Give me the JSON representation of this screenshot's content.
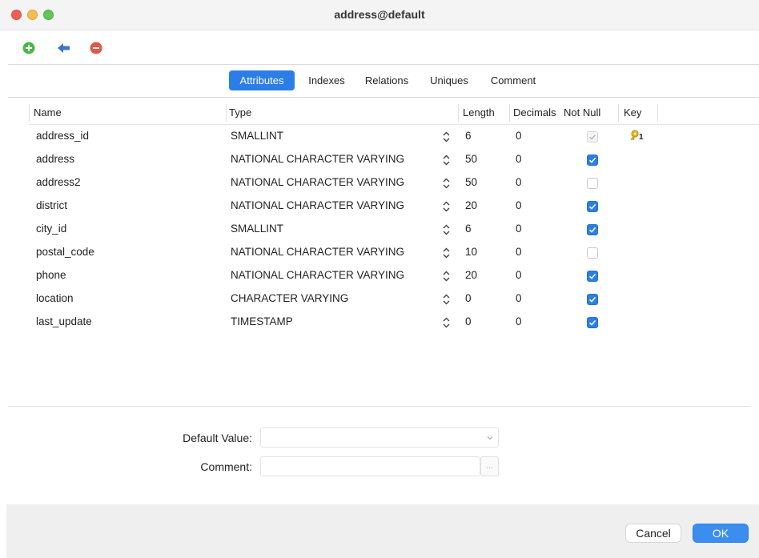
{
  "window": {
    "title": "address@default"
  },
  "toolbar": {
    "add_icon": "plus-circle-icon",
    "back_icon": "arrow-left-icon",
    "remove_icon": "minus-circle-icon"
  },
  "tabs": [
    {
      "label": "Attributes",
      "active": true
    },
    {
      "label": "Indexes",
      "active": false
    },
    {
      "label": "Relations",
      "active": false
    },
    {
      "label": "Uniques",
      "active": false
    },
    {
      "label": "Comment",
      "active": false
    }
  ],
  "grid": {
    "columns": {
      "name": "Name",
      "type": "Type",
      "length": "Length",
      "decimals": "Decimals",
      "not_null": "Not Null",
      "key": "Key"
    },
    "rows": [
      {
        "name": "address_id",
        "type": "SMALLINT",
        "length": "6",
        "decimals": "0",
        "not_null": "disabled-checked",
        "key": "1"
      },
      {
        "name": "address",
        "type": "NATIONAL CHARACTER VARYING",
        "length": "50",
        "decimals": "0",
        "not_null": "checked",
        "key": ""
      },
      {
        "name": "address2",
        "type": "NATIONAL CHARACTER VARYING",
        "length": "50",
        "decimals": "0",
        "not_null": "unchecked",
        "key": ""
      },
      {
        "name": "district",
        "type": "NATIONAL CHARACTER VARYING",
        "length": "20",
        "decimals": "0",
        "not_null": "checked",
        "key": ""
      },
      {
        "name": "city_id",
        "type": "SMALLINT",
        "length": "6",
        "decimals": "0",
        "not_null": "checked",
        "key": ""
      },
      {
        "name": "postal_code",
        "type": "NATIONAL CHARACTER VARYING",
        "length": "10",
        "decimals": "0",
        "not_null": "unchecked",
        "key": ""
      },
      {
        "name": "phone",
        "type": "NATIONAL CHARACTER VARYING",
        "length": "20",
        "decimals": "0",
        "not_null": "checked",
        "key": ""
      },
      {
        "name": "location",
        "type": "CHARACTER VARYING",
        "length": "0",
        "decimals": "0",
        "not_null": "checked",
        "key": ""
      },
      {
        "name": "last_update",
        "type": "TIMESTAMP",
        "length": "0",
        "decimals": "0",
        "not_null": "checked",
        "key": ""
      }
    ]
  },
  "form": {
    "default_value_label": "Default Value:",
    "default_value": "",
    "comment_label": "Comment:",
    "comment_value": "",
    "ellipsis": "..."
  },
  "footer": {
    "cancel_label": "Cancel",
    "ok_label": "OK"
  },
  "colors": {
    "accent": "#2b7ee8",
    "add": "#4cb748",
    "remove": "#e25745",
    "back": "#3a78c2",
    "key": "#e3b420"
  }
}
